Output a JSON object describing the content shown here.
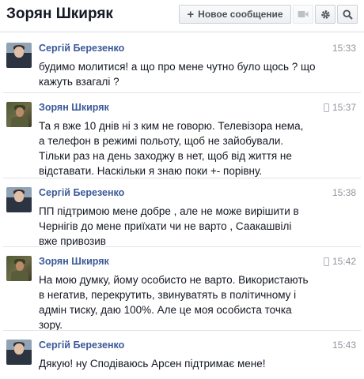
{
  "header": {
    "title": "Зорян Шкиряк",
    "new_message_label": "Новое сообщение"
  },
  "messages": [
    {
      "author": "Сергій Березенко",
      "time": "15:33",
      "mobile": false,
      "avatar": "ber",
      "lines": [
        "будимо молитися! а що про мене чутно було щось ? що",
        "кажуть взагалі ?"
      ]
    },
    {
      "author": "Зорян Шкиряк",
      "time": "15:37",
      "mobile": true,
      "avatar": "shk",
      "lines": [
        "Та я вже 10 днів ні з ким не говорю. Телевізора нема,",
        "а телефон в режимі польоту, щоб не зайобували.",
        "Тільки раз на день заходжу в нет, щоб від життя не",
        "відставати. Наскільки я знаю поки +- порівну."
      ]
    },
    {
      "author": "Сергій Березенко",
      "time": "15:38",
      "mobile": false,
      "avatar": "ber",
      "lines": [
        "ПП підтримою мене добре , але не може вирішити в",
        "Чернігів до мене приїхати чи не варто , Саакашвілі",
        "вже привозив"
      ]
    },
    {
      "author": "Зорян Шкиряк",
      "time": "15:42",
      "mobile": true,
      "avatar": "shk",
      "lines": [
        "На мою думку, йому особисто не варто. Використають",
        "в негатив, перекрутить, звинуватять в політичному і",
        "адмін тиску, даю 100%. Але це моя особиста точка",
        "зору."
      ]
    },
    {
      "author": "Сергій Березенко",
      "time": "15:43",
      "mobile": false,
      "avatar": "ber",
      "lines": [
        "Дякую! ну Сподіваюсь Арсен підтримає мене!"
      ]
    }
  ]
}
